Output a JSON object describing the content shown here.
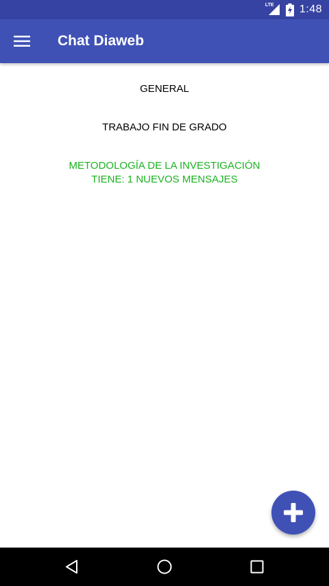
{
  "status_bar": {
    "network_label": "LTE",
    "time": "1:48"
  },
  "app_bar": {
    "title": "Chat Diaweb",
    "menu_icon": "hamburger-menu-icon"
  },
  "chats": [
    {
      "lines": [
        "GENERAL"
      ],
      "color": "#000000"
    },
    {
      "lines": [
        "TRABAJO FIN DE GRADO"
      ],
      "color": "#000000"
    },
    {
      "lines": [
        "METODOLOGÍA DE LA INVESTIGACIÓN",
        "TIENE: 1 NUEVOS MENSAJES"
      ],
      "color": "#19b31e"
    }
  ],
  "fab": {
    "icon": "plus-icon"
  },
  "nav_bar": {
    "icons": [
      "back-icon",
      "home-icon",
      "recents-icon"
    ]
  },
  "colors": {
    "primary": "#3f51b5",
    "primary_dark": "#3643a2",
    "new_message": "#19b31e"
  }
}
